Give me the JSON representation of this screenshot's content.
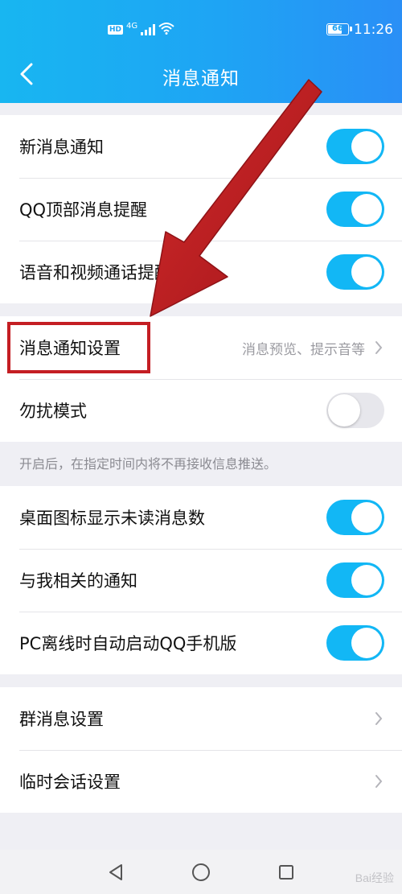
{
  "status_bar": {
    "hd_badge": "HD",
    "network": "4G",
    "battery": "66",
    "time": "11:26"
  },
  "header": {
    "title": "消息通知",
    "back_icon": "chevron-left-icon"
  },
  "group1": [
    {
      "label": "新消息通知",
      "toggle": "on"
    },
    {
      "label": "QQ顶部消息提醒",
      "toggle": "on"
    },
    {
      "label": "语音和视频通话提醒",
      "toggle": "on"
    }
  ],
  "group2": {
    "settings": {
      "label": "消息通知设置",
      "value": "消息预览、提示音等"
    },
    "dnd": {
      "label": "勿扰模式",
      "toggle": "off"
    }
  },
  "dnd_note": "开启后，在指定时间内将不再接收信息推送。",
  "group3": [
    {
      "label": "桌面图标显示未读消息数",
      "toggle": "on"
    },
    {
      "label": "与我相关的通知",
      "toggle": "on"
    },
    {
      "label": "PC离线时自动启动QQ手机版",
      "toggle": "on"
    }
  ],
  "group4": [
    {
      "label": "群消息设置"
    },
    {
      "label": "临时会话设置"
    }
  ],
  "nav": {
    "back_icon": "triangle-back-icon",
    "home_icon": "circle-home-icon",
    "recent_icon": "square-recents-icon"
  },
  "watermark": "Bai经验",
  "colors": {
    "header": "#1ea4f4",
    "toggle_on": "#12b7f5",
    "toggle_off": "#e7e7ec",
    "annotation_red": "#c41e23"
  }
}
